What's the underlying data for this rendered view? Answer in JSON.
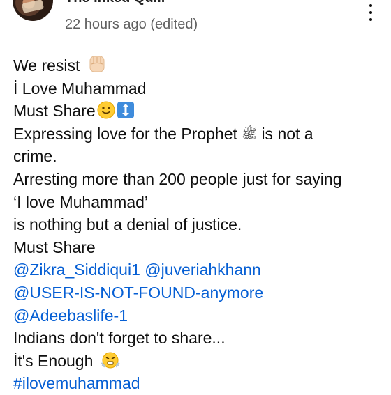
{
  "header": {
    "channel_name": "The Inked Quill",
    "timestamp": "22 hours ago (edited)"
  },
  "post": {
    "line1": "We resist",
    "line2": "İ Love Muhammad",
    "line3": "Must Share",
    "line4": "Expressing love for the Prophet",
    "line4_glyph": "ﷺ",
    "line4_tail": "is not a",
    "line5": "crime.",
    "line6": "Arresting more than 200 people just for saying",
    "line7": "‘I love Muhammad’",
    "line8": "is nothing but a denial of justice.",
    "line9": "Must Share",
    "mentions": [
      "@Zikra_Siddiqui1",
      "@juveriahkhann",
      "@USER-IS-NOT-FOUND-anymore",
      "@Adeebaslife-1"
    ],
    "line13": "Indians don't forget to share...",
    "line14": "İt's Enough",
    "hashtag": "#ilovemuhammad"
  },
  "icons": {
    "fist": "raised-fist-emoji",
    "smile": "smiling-face-emoji",
    "updown": "up-down-arrow-emoji",
    "steam": "face-with-steam-emoji",
    "menu": "more-vertical-icon"
  },
  "colors": {
    "link": "#065fd4",
    "text": "#0f0f0f",
    "muted": "#606060"
  }
}
